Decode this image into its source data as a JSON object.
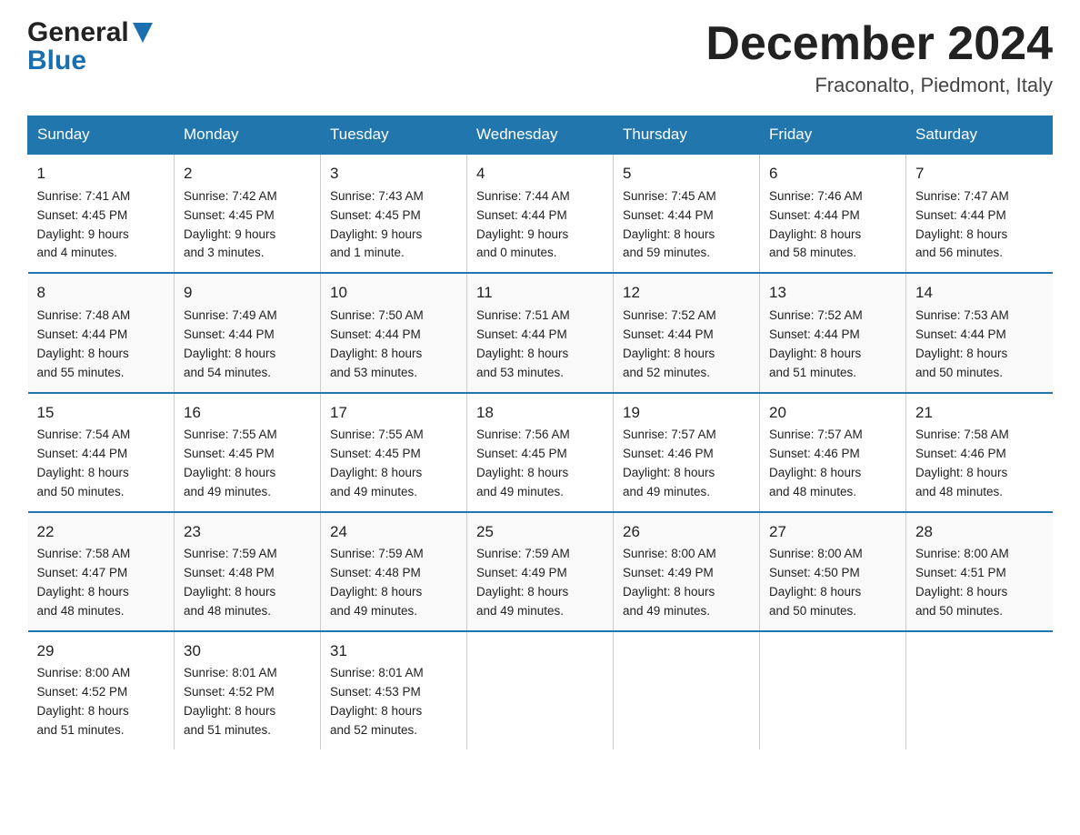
{
  "header": {
    "logo_general": "General",
    "logo_blue": "Blue",
    "main_title": "December 2024",
    "subtitle": "Fraconalto, Piedmont, Italy"
  },
  "weekdays": [
    "Sunday",
    "Monday",
    "Tuesday",
    "Wednesday",
    "Thursday",
    "Friday",
    "Saturday"
  ],
  "weeks": [
    [
      {
        "day": "1",
        "sunrise": "7:41 AM",
        "sunset": "4:45 PM",
        "daylight": "9 hours and 4 minutes."
      },
      {
        "day": "2",
        "sunrise": "7:42 AM",
        "sunset": "4:45 PM",
        "daylight": "9 hours and 3 minutes."
      },
      {
        "day": "3",
        "sunrise": "7:43 AM",
        "sunset": "4:45 PM",
        "daylight": "9 hours and 1 minute."
      },
      {
        "day": "4",
        "sunrise": "7:44 AM",
        "sunset": "4:44 PM",
        "daylight": "9 hours and 0 minutes."
      },
      {
        "day": "5",
        "sunrise": "7:45 AM",
        "sunset": "4:44 PM",
        "daylight": "8 hours and 59 minutes."
      },
      {
        "day": "6",
        "sunrise": "7:46 AM",
        "sunset": "4:44 PM",
        "daylight": "8 hours and 58 minutes."
      },
      {
        "day": "7",
        "sunrise": "7:47 AM",
        "sunset": "4:44 PM",
        "daylight": "8 hours and 56 minutes."
      }
    ],
    [
      {
        "day": "8",
        "sunrise": "7:48 AM",
        "sunset": "4:44 PM",
        "daylight": "8 hours and 55 minutes."
      },
      {
        "day": "9",
        "sunrise": "7:49 AM",
        "sunset": "4:44 PM",
        "daylight": "8 hours and 54 minutes."
      },
      {
        "day": "10",
        "sunrise": "7:50 AM",
        "sunset": "4:44 PM",
        "daylight": "8 hours and 53 minutes."
      },
      {
        "day": "11",
        "sunrise": "7:51 AM",
        "sunset": "4:44 PM",
        "daylight": "8 hours and 53 minutes."
      },
      {
        "day": "12",
        "sunrise": "7:52 AM",
        "sunset": "4:44 PM",
        "daylight": "8 hours and 52 minutes."
      },
      {
        "day": "13",
        "sunrise": "7:52 AM",
        "sunset": "4:44 PM",
        "daylight": "8 hours and 51 minutes."
      },
      {
        "day": "14",
        "sunrise": "7:53 AM",
        "sunset": "4:44 PM",
        "daylight": "8 hours and 50 minutes."
      }
    ],
    [
      {
        "day": "15",
        "sunrise": "7:54 AM",
        "sunset": "4:44 PM",
        "daylight": "8 hours and 50 minutes."
      },
      {
        "day": "16",
        "sunrise": "7:55 AM",
        "sunset": "4:45 PM",
        "daylight": "8 hours and 49 minutes."
      },
      {
        "day": "17",
        "sunrise": "7:55 AM",
        "sunset": "4:45 PM",
        "daylight": "8 hours and 49 minutes."
      },
      {
        "day": "18",
        "sunrise": "7:56 AM",
        "sunset": "4:45 PM",
        "daylight": "8 hours and 49 minutes."
      },
      {
        "day": "19",
        "sunrise": "7:57 AM",
        "sunset": "4:46 PM",
        "daylight": "8 hours and 49 minutes."
      },
      {
        "day": "20",
        "sunrise": "7:57 AM",
        "sunset": "4:46 PM",
        "daylight": "8 hours and 48 minutes."
      },
      {
        "day": "21",
        "sunrise": "7:58 AM",
        "sunset": "4:46 PM",
        "daylight": "8 hours and 48 minutes."
      }
    ],
    [
      {
        "day": "22",
        "sunrise": "7:58 AM",
        "sunset": "4:47 PM",
        "daylight": "8 hours and 48 minutes."
      },
      {
        "day": "23",
        "sunrise": "7:59 AM",
        "sunset": "4:48 PM",
        "daylight": "8 hours and 48 minutes."
      },
      {
        "day": "24",
        "sunrise": "7:59 AM",
        "sunset": "4:48 PM",
        "daylight": "8 hours and 49 minutes."
      },
      {
        "day": "25",
        "sunrise": "7:59 AM",
        "sunset": "4:49 PM",
        "daylight": "8 hours and 49 minutes."
      },
      {
        "day": "26",
        "sunrise": "8:00 AM",
        "sunset": "4:49 PM",
        "daylight": "8 hours and 49 minutes."
      },
      {
        "day": "27",
        "sunrise": "8:00 AM",
        "sunset": "4:50 PM",
        "daylight": "8 hours and 50 minutes."
      },
      {
        "day": "28",
        "sunrise": "8:00 AM",
        "sunset": "4:51 PM",
        "daylight": "8 hours and 50 minutes."
      }
    ],
    [
      {
        "day": "29",
        "sunrise": "8:00 AM",
        "sunset": "4:52 PM",
        "daylight": "8 hours and 51 minutes."
      },
      {
        "day": "30",
        "sunrise": "8:01 AM",
        "sunset": "4:52 PM",
        "daylight": "8 hours and 51 minutes."
      },
      {
        "day": "31",
        "sunrise": "8:01 AM",
        "sunset": "4:53 PM",
        "daylight": "8 hours and 52 minutes."
      },
      null,
      null,
      null,
      null
    ]
  ]
}
